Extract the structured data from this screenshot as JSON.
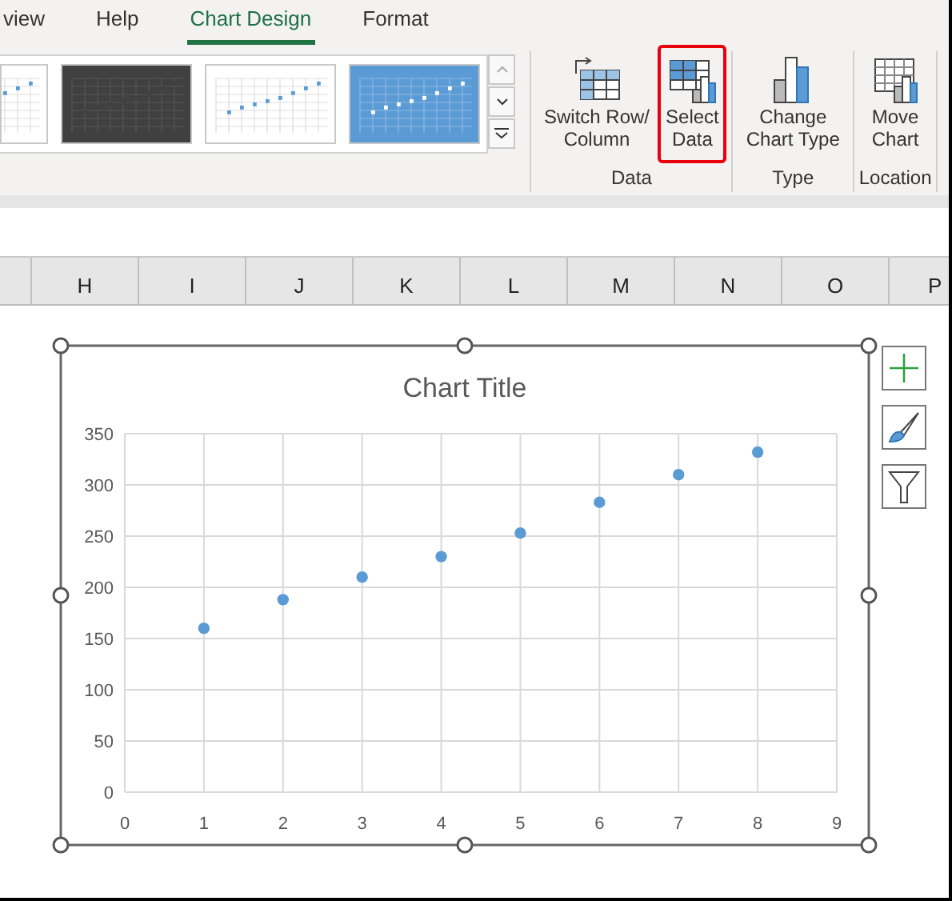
{
  "tabs": [
    {
      "label": "view",
      "selected": false
    },
    {
      "label": "Help",
      "selected": false
    },
    {
      "label": "Chart Design",
      "selected": true
    },
    {
      "label": "Format",
      "selected": false
    }
  ],
  "style_gallery": [
    {
      "kind": "light"
    },
    {
      "kind": "dark"
    },
    {
      "kind": "light"
    },
    {
      "kind": "blue"
    }
  ],
  "ribbon_groups": [
    {
      "label": "Data",
      "buttons": [
        {
          "lines": [
            "Switch Row/",
            "Column"
          ],
          "kind": "switch",
          "highlighted": false
        },
        {
          "lines": [
            "Select",
            "Data"
          ],
          "kind": "select",
          "highlighted": true
        }
      ]
    },
    {
      "label": "Type",
      "buttons": [
        {
          "lines": [
            "Change",
            "Chart Type"
          ],
          "kind": "type",
          "highlighted": false
        }
      ]
    },
    {
      "label": "Location",
      "buttons": [
        {
          "lines": [
            "Move",
            "Chart"
          ],
          "kind": "move",
          "highlighted": false
        }
      ]
    }
  ],
  "column_headers": [
    "H",
    "I",
    "J",
    "K",
    "L",
    "M",
    "N",
    "O",
    "P"
  ],
  "chart": {
    "selected": true,
    "chart_data": {
      "type": "scatter",
      "grid": true,
      "title": "Chart Title",
      "x": [
        1,
        2,
        3,
        4,
        5,
        6,
        7,
        8
      ],
      "series": [
        {
          "color": "#5b9bd5",
          "values": [
            160,
            188,
            210,
            230,
            253,
            283,
            310,
            332
          ]
        }
      ],
      "xlim": [
        0,
        9
      ],
      "ylim": [
        0,
        350
      ],
      "xticks": [
        0,
        1,
        2,
        3,
        4,
        5,
        6,
        7,
        8,
        9
      ],
      "yticks": [
        0,
        50,
        100,
        150,
        200,
        250,
        300,
        350
      ]
    }
  },
  "chart_tools": [
    {
      "kind": "elements"
    },
    {
      "kind": "styles"
    },
    {
      "kind": "filters"
    }
  ]
}
